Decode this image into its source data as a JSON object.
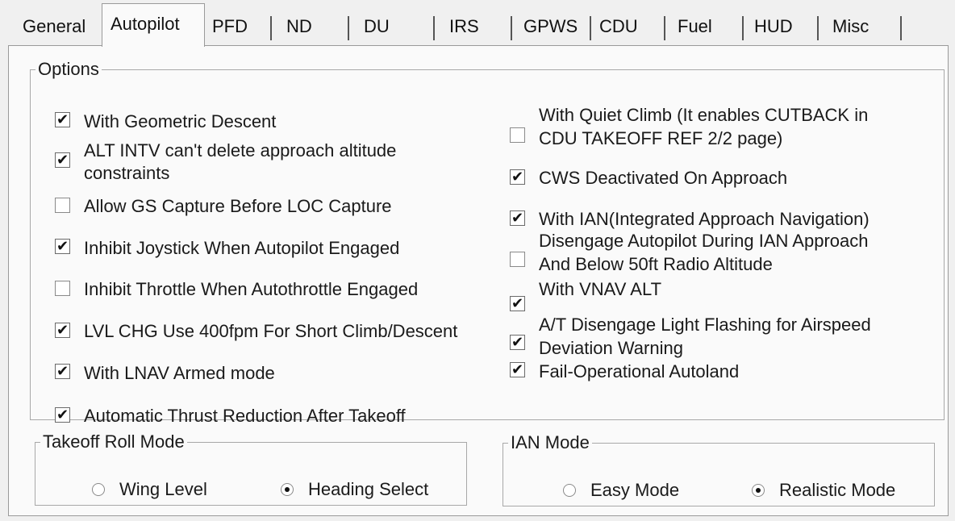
{
  "tabs": [
    {
      "label": "General",
      "active": false
    },
    {
      "label": "Autopilot",
      "active": true
    },
    {
      "label": "PFD",
      "active": false
    },
    {
      "label": "ND",
      "active": false
    },
    {
      "label": "DU",
      "active": false
    },
    {
      "label": "IRS",
      "active": false
    },
    {
      "label": "GPWS",
      "active": false
    },
    {
      "label": "CDU",
      "active": false
    },
    {
      "label": "Fuel",
      "active": false
    },
    {
      "label": "HUD",
      "active": false
    },
    {
      "label": "Misc",
      "active": false
    }
  ],
  "options": {
    "legend": "Options",
    "left": [
      {
        "line1": "With Geometric Descent",
        "line2": "",
        "checked": true
      },
      {
        "line1": "ALT INTV can't delete approach altitude",
        "line2": "constraints",
        "checked": true
      },
      {
        "line1": "Allow GS Capture Before LOC Capture",
        "line2": "",
        "checked": false
      },
      {
        "line1": "Inhibit Joystick When Autopilot Engaged",
        "line2": "",
        "checked": true
      },
      {
        "line1": "Inhibit Throttle When Autothrottle Engaged",
        "line2": "",
        "checked": false
      },
      {
        "line1": "LVL CHG Use 400fpm For Short Climb/Descent",
        "line2": "",
        "checked": true
      },
      {
        "line1": "With LNAV Armed mode",
        "line2": "",
        "checked": true
      },
      {
        "line1": "Automatic Thrust Reduction After Takeoff",
        "line2": "",
        "checked": true
      }
    ],
    "right": [
      {
        "line1": "With Quiet Climb (It enables CUTBACK in",
        "line2": "CDU TAKEOFF REF 2/2 page)",
        "checked": false
      },
      {
        "line1": "CWS Deactivated On Approach",
        "line2": "",
        "checked": true
      },
      {
        "line1": "With IAN(Integrated Approach Navigation)",
        "line2": "",
        "checked": true
      },
      {
        "line1": "Disengage Autopilot During IAN Approach",
        "line2": "And Below 50ft Radio Altitude",
        "checked": false
      },
      {
        "line1": "With VNAV ALT",
        "line2": "",
        "checked": true
      },
      {
        "line1": "A/T Disengage Light Flashing for Airspeed",
        "line2": "Deviation Warning",
        "checked": true
      },
      {
        "line1": "Fail-Operational Autoland",
        "line2": "",
        "checked": true
      }
    ]
  },
  "takeoff_roll": {
    "legend": "Takeoff Roll Mode",
    "options": [
      {
        "label": "Wing Level",
        "selected": false
      },
      {
        "label": "Heading Select",
        "selected": true
      }
    ]
  },
  "ian_mode": {
    "legend": "IAN Mode",
    "options": [
      {
        "label": "Easy Mode",
        "selected": false
      },
      {
        "label": "Realistic Mode",
        "selected": true
      }
    ]
  },
  "check_glyph": "✔"
}
